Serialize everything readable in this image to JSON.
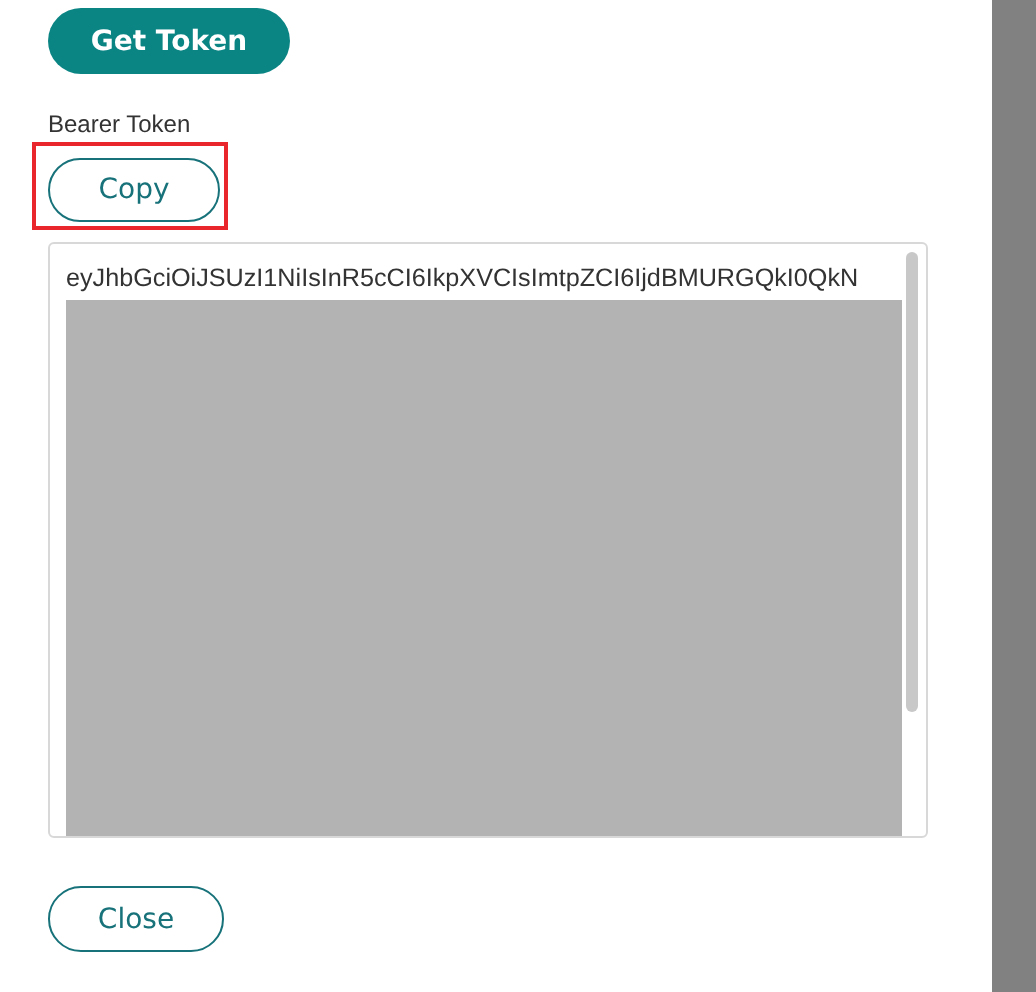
{
  "get_token_button": "Get Token",
  "token_label": "Bearer Token",
  "copy_button": "Copy",
  "token_text": "eyJhbGciOiJSUzI1NiIsInR5cCI6IkpXVCIsImtpZCI6IjdBMURGQkI0QkN",
  "close_button": "Close"
}
